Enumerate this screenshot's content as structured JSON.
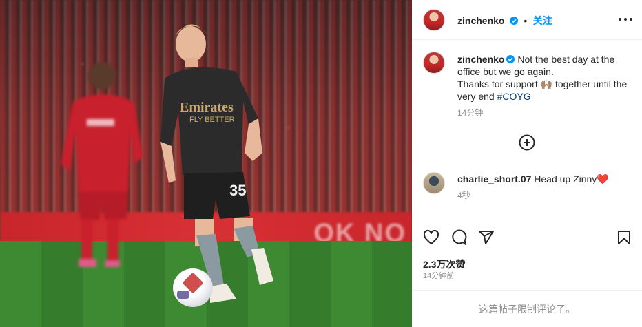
{
  "post": {
    "media_alt": "photo",
    "adboard_text": "OK NO"
  },
  "header": {
    "username": "zinchenko",
    "separator": "•",
    "follow_label": "关注",
    "more_icon": "more-horizontal-icon"
  },
  "caption": {
    "username": "zinchenko",
    "line1": "Not the best day at the office but we go again.",
    "line2_a": "Thanks for support ",
    "emoji": "🙌🏽",
    "line2_b": " together until the very end ",
    "hashtag": "#COYG",
    "time": "14分钟"
  },
  "load_more_icon": "plus-circle-icon",
  "comment": {
    "username": "charlie_short.07",
    "text": "Head up Zinny",
    "emoji": "❤️",
    "time": "4秒"
  },
  "actions": {
    "like_icon": "heart-icon",
    "comment_icon": "comment-icon",
    "share_icon": "send-icon",
    "save_icon": "bookmark-icon",
    "likes": "2.3万次赞",
    "posted": "14分钟前"
  },
  "footer": {
    "text": "这篇帖子限制评论了。"
  },
  "colors": {
    "accent": "#0095f6",
    "hashtag": "#00376b",
    "verified": "#0095f6",
    "heart": "#ed1c24"
  }
}
